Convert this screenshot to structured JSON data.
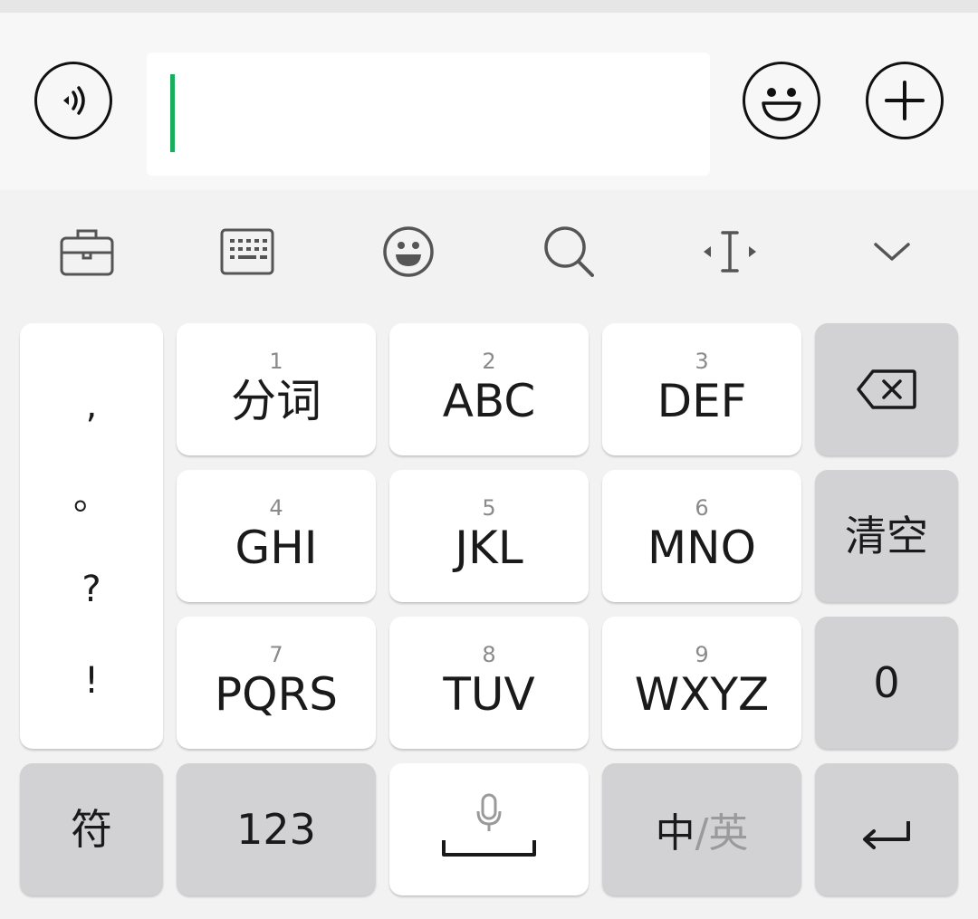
{
  "chat_input": {
    "value": "",
    "placeholder": ""
  },
  "icons": {
    "voice": "voice-icon",
    "emoji": "emoji-icon",
    "plus": "plus-icon",
    "toolbox": "toolbox-icon",
    "keyboard": "keyboard-icon",
    "keyboard_emoji": "smiley-icon",
    "search": "search-icon",
    "cursor": "cursor-move-icon",
    "collapse": "chevron-down-icon",
    "backspace": "backspace-icon",
    "mic": "microphone-icon",
    "enter": "enter-icon"
  },
  "keyboard": {
    "punctuation": [
      ",",
      "。",
      "?",
      "!"
    ],
    "digit_keys": [
      {
        "num": "1",
        "letters": "分词"
      },
      {
        "num": "2",
        "letters": "ABC"
      },
      {
        "num": "3",
        "letters": "DEF"
      },
      {
        "num": "4",
        "letters": "GHI"
      },
      {
        "num": "5",
        "letters": "JKL"
      },
      {
        "num": "6",
        "letters": "MNO"
      },
      {
        "num": "7",
        "letters": "PQRS"
      },
      {
        "num": "8",
        "letters": "TUV"
      },
      {
        "num": "9",
        "letters": "WXYZ"
      }
    ],
    "clear_label": "清空",
    "zero_label": "0",
    "symbol_label": "符",
    "numeric_label": "123",
    "lang_primary": "中",
    "lang_separator": "/",
    "lang_secondary": "英"
  },
  "colors": {
    "caret": "#1aad5c",
    "key_light": "#ffffff",
    "key_dark": "#d2d2d4",
    "background": "#f2f2f2"
  }
}
